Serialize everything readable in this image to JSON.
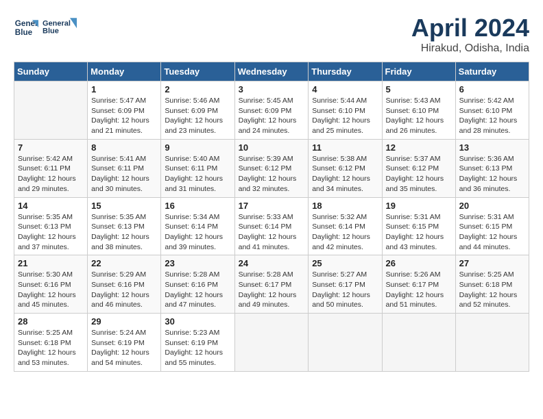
{
  "header": {
    "logo_line1": "General",
    "logo_line2": "Blue",
    "title": "April 2024",
    "subtitle": "Hirakud, Odisha, India"
  },
  "calendar": {
    "days_of_week": [
      "Sunday",
      "Monday",
      "Tuesday",
      "Wednesday",
      "Thursday",
      "Friday",
      "Saturday"
    ],
    "weeks": [
      [
        {
          "day": "",
          "info": ""
        },
        {
          "day": "1",
          "info": "Sunrise: 5:47 AM\nSunset: 6:09 PM\nDaylight: 12 hours\nand 21 minutes."
        },
        {
          "day": "2",
          "info": "Sunrise: 5:46 AM\nSunset: 6:09 PM\nDaylight: 12 hours\nand 23 minutes."
        },
        {
          "day": "3",
          "info": "Sunrise: 5:45 AM\nSunset: 6:09 PM\nDaylight: 12 hours\nand 24 minutes."
        },
        {
          "day": "4",
          "info": "Sunrise: 5:44 AM\nSunset: 6:10 PM\nDaylight: 12 hours\nand 25 minutes."
        },
        {
          "day": "5",
          "info": "Sunrise: 5:43 AM\nSunset: 6:10 PM\nDaylight: 12 hours\nand 26 minutes."
        },
        {
          "day": "6",
          "info": "Sunrise: 5:42 AM\nSunset: 6:10 PM\nDaylight: 12 hours\nand 28 minutes."
        }
      ],
      [
        {
          "day": "7",
          "info": "Sunrise: 5:42 AM\nSunset: 6:11 PM\nDaylight: 12 hours\nand 29 minutes."
        },
        {
          "day": "8",
          "info": "Sunrise: 5:41 AM\nSunset: 6:11 PM\nDaylight: 12 hours\nand 30 minutes."
        },
        {
          "day": "9",
          "info": "Sunrise: 5:40 AM\nSunset: 6:11 PM\nDaylight: 12 hours\nand 31 minutes."
        },
        {
          "day": "10",
          "info": "Sunrise: 5:39 AM\nSunset: 6:12 PM\nDaylight: 12 hours\nand 32 minutes."
        },
        {
          "day": "11",
          "info": "Sunrise: 5:38 AM\nSunset: 6:12 PM\nDaylight: 12 hours\nand 34 minutes."
        },
        {
          "day": "12",
          "info": "Sunrise: 5:37 AM\nSunset: 6:12 PM\nDaylight: 12 hours\nand 35 minutes."
        },
        {
          "day": "13",
          "info": "Sunrise: 5:36 AM\nSunset: 6:13 PM\nDaylight: 12 hours\nand 36 minutes."
        }
      ],
      [
        {
          "day": "14",
          "info": "Sunrise: 5:35 AM\nSunset: 6:13 PM\nDaylight: 12 hours\nand 37 minutes."
        },
        {
          "day": "15",
          "info": "Sunrise: 5:35 AM\nSunset: 6:13 PM\nDaylight: 12 hours\nand 38 minutes."
        },
        {
          "day": "16",
          "info": "Sunrise: 5:34 AM\nSunset: 6:14 PM\nDaylight: 12 hours\nand 39 minutes."
        },
        {
          "day": "17",
          "info": "Sunrise: 5:33 AM\nSunset: 6:14 PM\nDaylight: 12 hours\nand 41 minutes."
        },
        {
          "day": "18",
          "info": "Sunrise: 5:32 AM\nSunset: 6:14 PM\nDaylight: 12 hours\nand 42 minutes."
        },
        {
          "day": "19",
          "info": "Sunrise: 5:31 AM\nSunset: 6:15 PM\nDaylight: 12 hours\nand 43 minutes."
        },
        {
          "day": "20",
          "info": "Sunrise: 5:31 AM\nSunset: 6:15 PM\nDaylight: 12 hours\nand 44 minutes."
        }
      ],
      [
        {
          "day": "21",
          "info": "Sunrise: 5:30 AM\nSunset: 6:16 PM\nDaylight: 12 hours\nand 45 minutes."
        },
        {
          "day": "22",
          "info": "Sunrise: 5:29 AM\nSunset: 6:16 PM\nDaylight: 12 hours\nand 46 minutes."
        },
        {
          "day": "23",
          "info": "Sunrise: 5:28 AM\nSunset: 6:16 PM\nDaylight: 12 hours\nand 47 minutes."
        },
        {
          "day": "24",
          "info": "Sunrise: 5:28 AM\nSunset: 6:17 PM\nDaylight: 12 hours\nand 49 minutes."
        },
        {
          "day": "25",
          "info": "Sunrise: 5:27 AM\nSunset: 6:17 PM\nDaylight: 12 hours\nand 50 minutes."
        },
        {
          "day": "26",
          "info": "Sunrise: 5:26 AM\nSunset: 6:17 PM\nDaylight: 12 hours\nand 51 minutes."
        },
        {
          "day": "27",
          "info": "Sunrise: 5:25 AM\nSunset: 6:18 PM\nDaylight: 12 hours\nand 52 minutes."
        }
      ],
      [
        {
          "day": "28",
          "info": "Sunrise: 5:25 AM\nSunset: 6:18 PM\nDaylight: 12 hours\nand 53 minutes."
        },
        {
          "day": "29",
          "info": "Sunrise: 5:24 AM\nSunset: 6:19 PM\nDaylight: 12 hours\nand 54 minutes."
        },
        {
          "day": "30",
          "info": "Sunrise: 5:23 AM\nSunset: 6:19 PM\nDaylight: 12 hours\nand 55 minutes."
        },
        {
          "day": "",
          "info": ""
        },
        {
          "day": "",
          "info": ""
        },
        {
          "day": "",
          "info": ""
        },
        {
          "day": "",
          "info": ""
        }
      ]
    ]
  }
}
